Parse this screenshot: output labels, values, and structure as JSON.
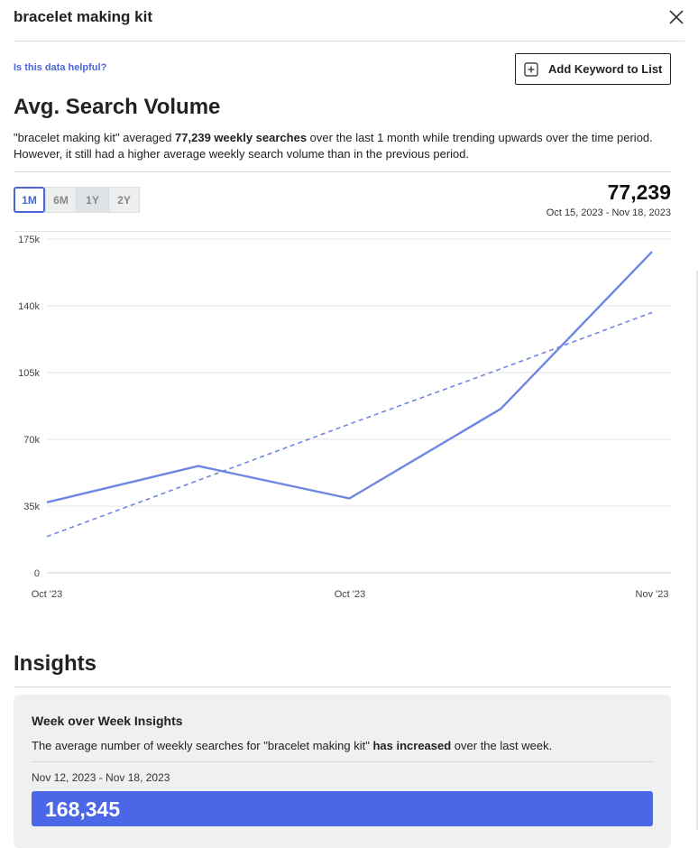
{
  "header": {
    "title": "bracelet making kit"
  },
  "helpful_link": "Is this data helpful?",
  "add_keyword_label": "Add Keyword to List",
  "search_volume": {
    "title": "Avg. Search Volume",
    "summary_pre": "\"bracelet making kit\" averaged ",
    "summary_bold": "77,239 weekly searches",
    "summary_post": " over the last 1 month while trending upwards over the time period. However, it still had a higher average weekly search volume than in the previous period.",
    "ranges": [
      "1M",
      "6M",
      "1Y",
      "2Y"
    ],
    "selected_range": "1M",
    "value": "77,239",
    "date_range": "Oct 15, 2023 - Nov 18, 2023"
  },
  "chart_data": {
    "type": "line",
    "x_tick_labels": [
      "Oct '23",
      "Oct '23",
      "Nov '23"
    ],
    "y_ticks": [
      {
        "value": 0,
        "label": "0"
      },
      {
        "value": 35000,
        "label": "35k"
      },
      {
        "value": 70000,
        "label": "70k"
      },
      {
        "value": 105000,
        "label": "105k"
      },
      {
        "value": 140000,
        "label": "140k"
      },
      {
        "value": 175000,
        "label": "175k"
      }
    ],
    "ylim": [
      0,
      175000
    ],
    "grid": true,
    "series": [
      {
        "style": "solid",
        "color": "#6f86e2",
        "values": [
          37000,
          56000,
          39000,
          86000,
          168345
        ]
      },
      {
        "style": "dashed",
        "color": "#6f86e2",
        "values": [
          19000,
          48500,
          78000,
          107000,
          136500
        ]
      }
    ]
  },
  "insights": {
    "title": "Insights",
    "card_title": "Week over Week Insights",
    "text_pre": "The average number of weekly searches for \"bracelet making kit\" ",
    "text_bold": "has increased",
    "text_post": " over the last week.",
    "dates": "Nov 12, 2023 - Nov 18, 2023",
    "value": "168,345",
    "accent": "#4b66e6"
  }
}
